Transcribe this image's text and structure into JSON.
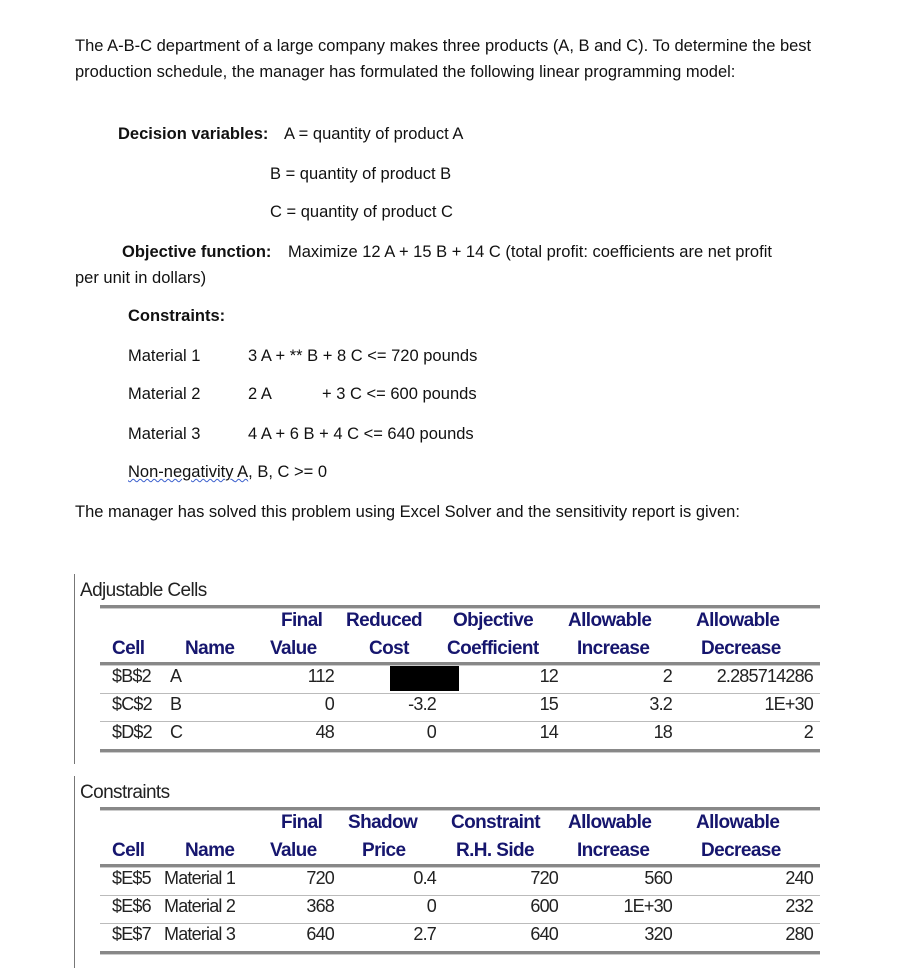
{
  "intro": "The A-B-C department of a large company makes three products (A, B and C). To determine the best production schedule, the manager has formulated the following linear programming model:",
  "decision": {
    "label": "Decision variables:",
    "vars": [
      "A = quantity of product A",
      "B = quantity of product B",
      "C = quantity of product C"
    ]
  },
  "objective": {
    "label": "Objective function:",
    "text": "Maximize 12 A + 15 B + 14 C (total profit: coefficients are net profit",
    "cont": "per unit in dollars)"
  },
  "constraints": {
    "label": "Constraints:",
    "rows": [
      {
        "name": "Material 1",
        "expr": "3 A + ** B + 8 C <= 720 pounds"
      },
      {
        "name": "Material 2",
        "expr_a": "2 A",
        "expr_b": "+ 3 C <= 600 pounds"
      },
      {
        "name": "Material 3",
        "expr": "4 A + 6 B + 4 C <= 640 pounds"
      }
    ],
    "nonneg_label": "Non-negativity",
    "nonneg_a": " A",
    "nonneg_rest": ", B, C >= 0"
  },
  "outro": "The manager has solved this problem using Excel Solver and the sensitivity report is given:",
  "adjustable": {
    "title": "Adjustable Cells",
    "headers_top": [
      "",
      "",
      "Final",
      "Reduced",
      "Objective",
      "Allowable",
      "Allowable"
    ],
    "headers_bottom": [
      "Cell",
      "Name",
      "Value",
      "Cost",
      "Coefficient",
      "Increase",
      "Decrease"
    ],
    "rows": [
      [
        "$B$2",
        "A",
        "112",
        "",
        "12",
        "2",
        "2.285714286"
      ],
      [
        "$C$2",
        "B",
        "0",
        "-3.2",
        "15",
        "3.2",
        "1E+30"
      ],
      [
        "$D$2",
        "C",
        "48",
        "0",
        "14",
        "18",
        "2"
      ]
    ]
  },
  "constraint_report": {
    "title": "Constraints",
    "headers_top": [
      "",
      "",
      "Final",
      "Shadow",
      "Constraint",
      "Allowable",
      "Allowable"
    ],
    "headers_bottom": [
      "Cell",
      "Name",
      "Value",
      "Price",
      "R.H. Side",
      "Increase",
      "Decrease"
    ],
    "rows": [
      [
        "$E$5",
        "Material 1",
        "720",
        "0.4",
        "720",
        "560",
        "240"
      ],
      [
        "$E$6",
        "Material 2",
        "368",
        "0",
        "600",
        "1E+30",
        "232"
      ],
      [
        "$E$7",
        "Material 3",
        "640",
        "2.7",
        "640",
        "320",
        "280"
      ]
    ]
  },
  "colors": {
    "header_text": "#16166e",
    "redaction": "#000000"
  }
}
